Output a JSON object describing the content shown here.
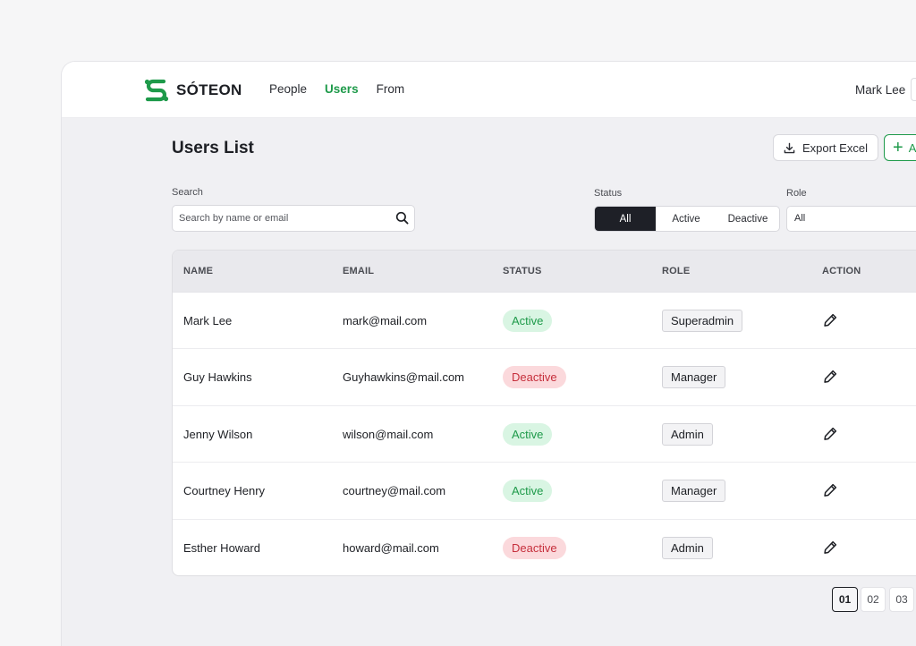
{
  "brand": {
    "name": "SÓTEON",
    "color": "#1e9a4a"
  },
  "nav": {
    "items": [
      "People",
      "Users",
      "From"
    ],
    "active": "Users"
  },
  "user": {
    "name": "Mark Lee"
  },
  "page": {
    "title": "Users List",
    "export_label": "Export Excel",
    "add_label": "A"
  },
  "filters": {
    "search_label": "Search",
    "search_placeholder": "Search by name or email",
    "status_label": "Status",
    "status_options": [
      "All",
      "Active",
      "Deactive"
    ],
    "status_selected": "All",
    "role_label": "Role",
    "role_value": "All"
  },
  "table": {
    "columns": [
      "NAME",
      "EMAIL",
      "STATUS",
      "ROLE",
      "ACTION"
    ],
    "rows": [
      {
        "name": "Mark Lee",
        "email": "mark@mail.com",
        "status": "Active",
        "role": "Superadmin"
      },
      {
        "name": "Guy Hawkins",
        "email": "Guyhawkins@mail.com",
        "status": "Deactive",
        "role": "Manager"
      },
      {
        "name": "Jenny Wilson",
        "email": "wilson@mail.com",
        "status": "Active",
        "role": "Admin"
      },
      {
        "name": "Courtney Henry",
        "email": "courtney@mail.com",
        "status": "Active",
        "role": "Manager"
      },
      {
        "name": "Esther Howard",
        "email": "howard@mail.com",
        "status": "Deactive",
        "role": "Admin"
      }
    ]
  },
  "pagination": {
    "pages": [
      "01",
      "02",
      "03"
    ],
    "current": "01"
  },
  "icons": {
    "edit": "pencil-icon",
    "search": "search-icon",
    "export": "download-icon",
    "add": "plus-icon"
  },
  "colors": {
    "active_bg": "#d9f5e3",
    "active_fg": "#1e9a4a",
    "deactive_bg": "#fbd9dc",
    "deactive_fg": "#c62f3c"
  }
}
